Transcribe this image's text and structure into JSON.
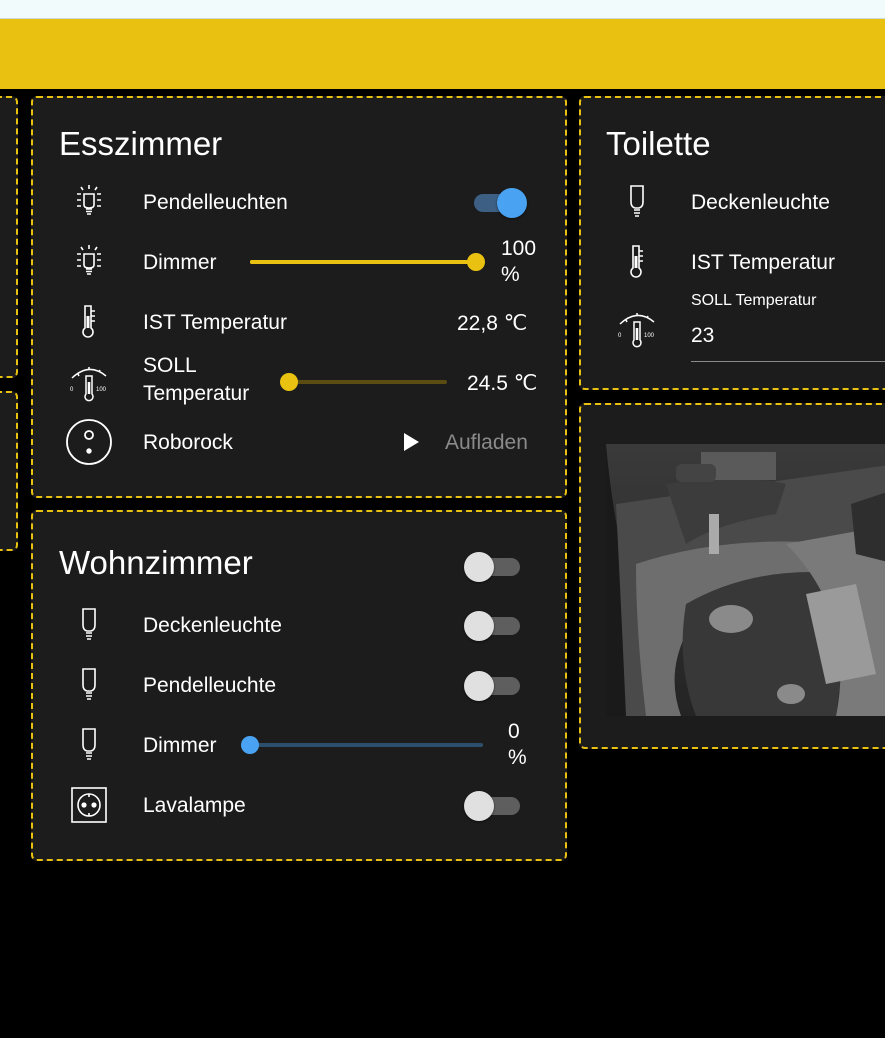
{
  "colors": {
    "accent": "#e9c211",
    "card_bg": "#1c1c1c",
    "toggle_on": "#4aa3f2",
    "slider_blue": "#4aa3f2"
  },
  "esszimmer": {
    "title": "Esszimmer",
    "rows": [
      {
        "label": "Pendelleuchten",
        "icon": "ceiling-light-on-icon",
        "toggle": true
      },
      {
        "label": "Dimmer",
        "icon": "ceiling-light-on-icon",
        "level": 1.0,
        "value_num": "100",
        "value_unit": "%"
      },
      {
        "label": "IST Temperatur",
        "icon": "thermometer-icon",
        "value": "22,8 ℃"
      },
      {
        "label1": "SOLL",
        "label2": "Temperatur",
        "icon": "thermostat-dial-icon",
        "level": 0.0,
        "value": "24.5 ℃"
      },
      {
        "label": "Roborock",
        "icon": "robot-vacuum-icon",
        "value": "Aufladen"
      }
    ]
  },
  "wohnzimmer": {
    "title": "Wohnzimmer",
    "master_toggle": false,
    "rows": [
      {
        "label": "Deckenleuchte",
        "icon": "light-bulb-icon",
        "toggle": false
      },
      {
        "label": "Pendelleuchte",
        "icon": "light-bulb-icon",
        "toggle": false
      },
      {
        "label": "Dimmer",
        "icon": "light-bulb-icon",
        "level": 0.0,
        "value_num": "0",
        "value_unit": "%"
      },
      {
        "label": "Lavalampe",
        "icon": "power-socket-icon",
        "toggle": false
      }
    ]
  },
  "toilette": {
    "title": "Toilette",
    "rows": [
      {
        "label": "Deckenleuchte",
        "icon": "light-bulb-icon"
      },
      {
        "label": "IST Temperatur",
        "icon": "thermometer-icon"
      },
      {
        "field_label": "SOLL Temperatur",
        "field_value": "23",
        "icon": "thermostat-dial-icon"
      }
    ]
  },
  "camera": {
    "icon": "camera-feed-image"
  }
}
